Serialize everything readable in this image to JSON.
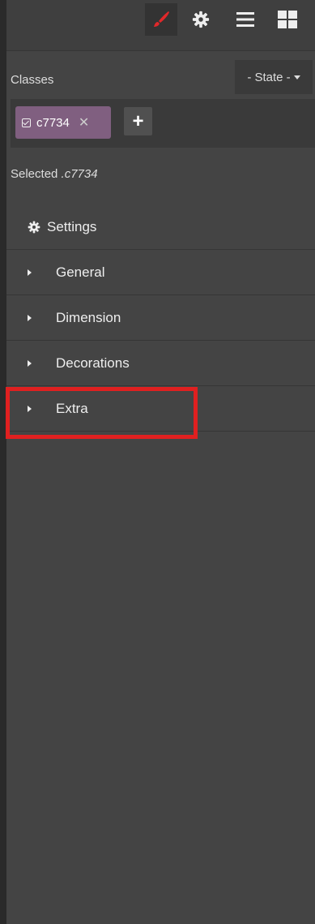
{
  "toolbar": {
    "buttons": [
      {
        "icon": "paint-brush-icon",
        "active": true,
        "color": "#e0282a"
      },
      {
        "icon": "gear-icon",
        "active": false
      },
      {
        "icon": "menu-icon",
        "active": false
      },
      {
        "icon": "blocks-icon",
        "active": false
      }
    ]
  },
  "classes": {
    "label": "Classes",
    "state_select": "- State -",
    "tags": [
      {
        "name": "c7734",
        "close": "✕"
      }
    ],
    "add_label": "+",
    "selected_prefix": "Selected",
    "selected_value": ".c7734"
  },
  "settings": {
    "label": "Settings"
  },
  "sectors": [
    {
      "label": "General"
    },
    {
      "label": "Dimension"
    },
    {
      "label": "Decorations"
    },
    {
      "label": "Extra"
    }
  ],
  "colors": {
    "tag_bg": "#805f80",
    "accent": "#e0282a",
    "highlight": "#e02020"
  }
}
